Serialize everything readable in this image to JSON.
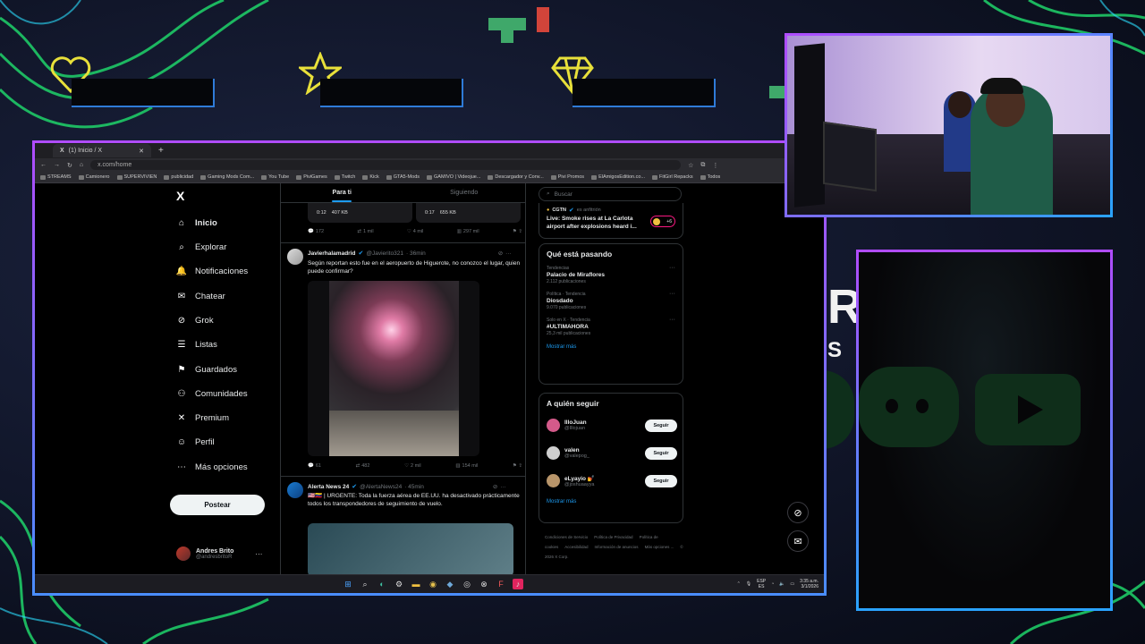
{
  "browser": {
    "tab_title": "(1) Inicio / X",
    "url": "x.com/home",
    "bookmarks": [
      "STREAMS",
      "Camionero",
      "SUPERVIVIEN",
      "publicidad",
      "Gaming Mods Com...",
      "You Tube",
      "PiviGames",
      "Twitch",
      "Kick",
      "GTA5-Mods",
      "GAMIVO | Videojue...",
      "Descargador y Conv...",
      "Pivi Promos",
      "ElAmigosEdition.co...",
      "FitGirl Repacks",
      "Todos"
    ]
  },
  "nav": {
    "logo": "X",
    "items": [
      {
        "label": "Inicio",
        "icon": "home-icon",
        "glyph": "⌂"
      },
      {
        "label": "Explorar",
        "icon": "search-icon",
        "glyph": "⌕"
      },
      {
        "label": "Notificaciones",
        "icon": "bell-icon",
        "glyph": "🔔"
      },
      {
        "label": "Chatear",
        "icon": "mail-icon",
        "glyph": "✉"
      },
      {
        "label": "Grok",
        "icon": "grok-icon",
        "glyph": "⊘"
      },
      {
        "label": "Listas",
        "icon": "list-icon",
        "glyph": "☰"
      },
      {
        "label": "Guardados",
        "icon": "bookmark-icon",
        "glyph": "⚑"
      },
      {
        "label": "Comunidades",
        "icon": "communities-icon",
        "glyph": "⚇"
      },
      {
        "label": "Premium",
        "icon": "x-premium-icon",
        "glyph": "✕"
      },
      {
        "label": "Perfil",
        "icon": "person-icon",
        "glyph": "☺"
      },
      {
        "label": "Más opciones",
        "icon": "more-circle-icon",
        "glyph": "⋯"
      }
    ],
    "post_button": "Postear",
    "profile_name": "Andres Brito",
    "profile_handle": "@andresbritoR",
    "profile_more": "···"
  },
  "feed": {
    "tabs": [
      "Para ti",
      "Siguiendo"
    ],
    "media_top": [
      {
        "duration": "0:12",
        "size": "407 KB"
      },
      {
        "duration": "0:17",
        "size": "655 KB"
      }
    ],
    "top_actions": {
      "replies": "172",
      "reposts": "1 mil",
      "likes": "4 mil",
      "views": "297 mil"
    },
    "tweet1": {
      "name": "Javierhalamadrid",
      "handle": "@Javierito321",
      "time": "· 36min",
      "text": "Según reportan esto fue en el aeropuerto de Higuerote, no conozco el lugar, quien puede confirmar?",
      "replies": "61",
      "reposts": "482",
      "likes": "2 mil",
      "views": "154 mil"
    },
    "tweet2": {
      "name": "Alerta News 24",
      "handle": "@AlertaNews24",
      "time": "· 45min",
      "text": "🇺🇸🇻🇪 | URGENTE: Toda la fuerza aérea de EE.UU. ha desactivado prácticamente todos los transpondedores de seguimiento de vuelo."
    }
  },
  "right": {
    "search_placeholder": "Buscar",
    "live": {
      "source": "CGTN",
      "source_suffix": "es anfitrión",
      "title": "Live: Smoke rises at La Carlota airport after explosions heard i...",
      "badge": "+6"
    },
    "trending": {
      "title": "Qué está pasando",
      "items": [
        {
          "category": "Tendencias",
          "name": "Palacio de Miraflores",
          "count": "2.112 publicaciones"
        },
        {
          "category": "Política · Tendencia",
          "name": "Diosdado",
          "count": "9.070 publicaciones"
        },
        {
          "category": "Solo en X · Tendencia",
          "name": "#ULTIMAHORA",
          "count": "25,3 mil publicaciones"
        }
      ],
      "more": "Mostrar más"
    },
    "who_to_follow": {
      "title": "A quién seguir",
      "items": [
        {
          "name": "IlloJuan",
          "handle": "@Illojuan",
          "button": "Seguir",
          "color": "#d45a8a"
        },
        {
          "name": "valen",
          "handle": "@valepog_",
          "button": "Seguir",
          "color": "#cfcfcf"
        },
        {
          "name": "eLyayio 💅",
          "handle": "@joshuaayya",
          "button": "Seguir",
          "color": "#b8956a"
        }
      ],
      "more": "Mostrar más"
    },
    "footer": [
      "Condiciones de Servicio",
      "Política de Privacidad",
      "Política de cookies",
      "Accesibilidad",
      "Información de anuncios",
      "Más opciones ...",
      "© 2026 X Corp."
    ]
  },
  "taskbar": {
    "lang": "ESP",
    "lang2": "ES",
    "time": "3:35 a.m.",
    "date": "3/1/2026"
  },
  "overlay": {
    "side_letter": "R",
    "side_s": "S"
  }
}
